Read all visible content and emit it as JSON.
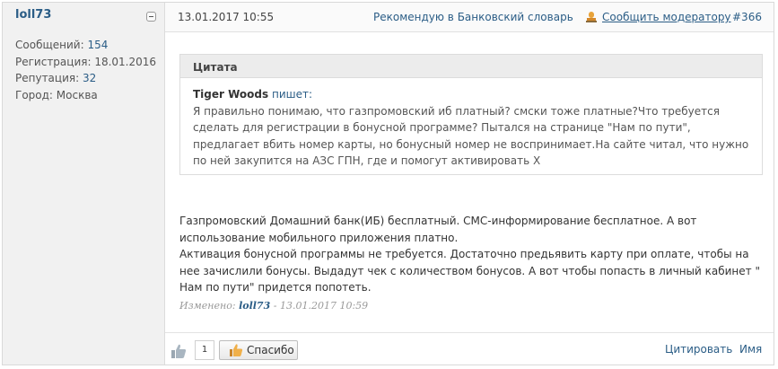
{
  "user": {
    "name": "loll73",
    "stats": [
      {
        "label": "Сообщений: ",
        "value": "154"
      },
      {
        "label": "Регистрация: ",
        "value": "18.01.2016"
      },
      {
        "label": "Репутация: ",
        "value": "32"
      },
      {
        "label": "Город: ",
        "value": "Москва"
      }
    ]
  },
  "header": {
    "date": "13.01.2017 10:55",
    "recommend": "Рекомендую в Банковский словарь",
    "report": "Сообщить модератору",
    "post_number": "#366"
  },
  "quote": {
    "title": "Цитата",
    "author": "Tiger Woods",
    "writes": "пишет:",
    "text": "Я правильно понимаю, что газпромовский иб платный? смски тоже платные?Что требуется сделать для регистрации в бонусной программе? Пытался на странице \"Нам по пути\", предлагает вбить номер карты, но бонусный номер не воспринимает.На сайте читал, что нужно по ней закупится на АЗС ГПН, где и помогут активировать Х"
  },
  "message": {
    "paragraph1": "Газпромовский Домашний банк(ИБ) бесплатный. СМС-информирование бесплатное. А вот использование мобильного приложения платно.",
    "paragraph2": "Активация бонусной программы не требуется. Достаточно предьявить карту при оплате, чтобы на нее зачислили бонусы. Выдадут чек с количеством бонусов. А вот чтобы попасть в личный кабинет \" Нам по пути\" придется попотеть."
  },
  "edited": {
    "label": "Изменено:",
    "editor": "loll73",
    "date": "- 13.01.2017 10:59"
  },
  "footer": {
    "like_count": "1",
    "thanks_label": "Спасибо",
    "quote_label": "Цитировать",
    "name_label": "Имя"
  },
  "icons": [
    "collapse-icon",
    "report-icon",
    "thumbs-up-icon",
    "thanks-hand-icon"
  ],
  "colors": {
    "link": "#2b5d86",
    "sidebar_bg": "#f1f1f1",
    "quote_head_bg": "#ececec"
  }
}
